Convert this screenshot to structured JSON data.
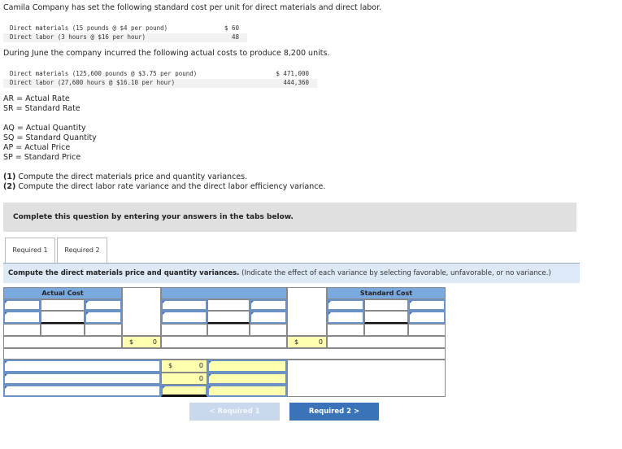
{
  "intro": "Camila Company has set the following standard cost per unit for direct materials and direct labor.",
  "standard": [
    {
      "label": "Direct materials (15 pounds @ $4 per pound)",
      "value": "$ 60"
    },
    {
      "label": "Direct labor (3 hours @ $16 per hour)",
      "value": "48"
    }
  ],
  "actual_intro": "During June the company incurred the following actual costs to produce 8,200 units.",
  "actual": [
    {
      "label": "Direct materials (125,600 pounds @ $3.75 per pound)",
      "value": "$ 471,000"
    },
    {
      "label": "Direct labor (27,600 hours @ $16.10 per hour)",
      "value": "444,360"
    }
  ],
  "legend1": [
    "AR = Actual Rate",
    "SR = Standard Rate"
  ],
  "legend2": [
    "AQ = Actual Quantity",
    "SQ = Standard Quantity",
    "AP = Actual Price",
    "SP = Standard Price"
  ],
  "tasks": [
    {
      "num": "(1)",
      "text": " Compute the direct materials price and quantity variances."
    },
    {
      "num": "(2)",
      "text": " Compute the direct labor rate variance and the direct labor efficiency variance."
    }
  ],
  "banner": "Complete this question by entering your answers in the tabs below.",
  "tabs": [
    "Required 1",
    "Required 2"
  ],
  "instruction": "Compute the direct materials price and quantity variances.",
  "instruction_note": " (Indicate the effect of each variance by selecting favorable, unfavorable, or no variance.)",
  "table": {
    "actual_header": "Actual Cost",
    "standard_header": "Standard Cost",
    "currency": "$",
    "total1": "0",
    "total2": "0",
    "var1": "0",
    "var2": "0"
  },
  "nav": {
    "prev": "< Required 1",
    "next": "Required 2 >"
  },
  "colors": {
    "header_blue": "#7aa9e0",
    "input_yellow": "#ffffb0",
    "next_button": "#3a73b8",
    "prev_button": "#c9d8ec"
  }
}
